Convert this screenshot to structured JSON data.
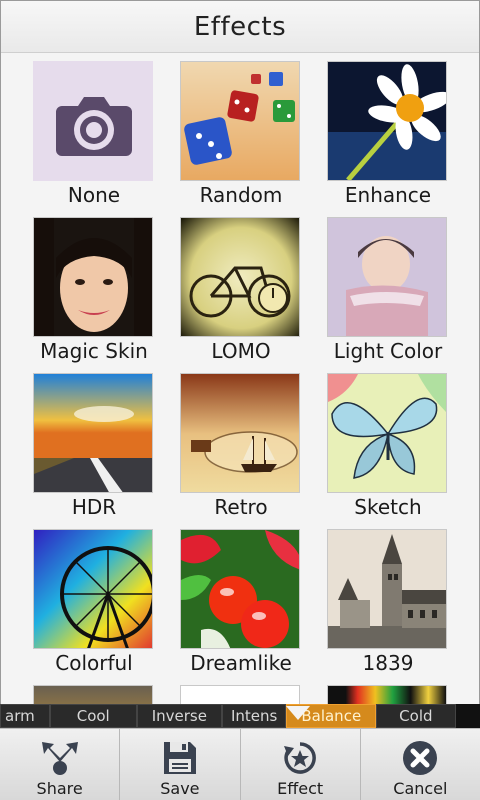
{
  "dialog": {
    "title": "Effects"
  },
  "effects": [
    {
      "label": "None",
      "icon": "camera-icon"
    },
    {
      "label": "Random",
      "icon": "dice-image"
    },
    {
      "label": "Enhance",
      "icon": "daisy-image"
    },
    {
      "label": "Magic Skin",
      "icon": "portrait-image"
    },
    {
      "label": "LOMO",
      "icon": "bicycle-image"
    },
    {
      "label": "Light Color",
      "icon": "girl-scarf-image"
    },
    {
      "label": "HDR",
      "icon": "road-sunset-image"
    },
    {
      "label": "Retro",
      "icon": "ship-bottle-image"
    },
    {
      "label": "Sketch",
      "icon": "butterfly-image"
    },
    {
      "label": "Colorful",
      "icon": "ferris-wheel-image"
    },
    {
      "label": "Dreamlike",
      "icon": "peppers-image"
    },
    {
      "label": "1839",
      "icon": "castle-image"
    }
  ],
  "strip": {
    "items": [
      "arm",
      "Cool",
      "Inverse",
      "Intens",
      "Balance",
      "Cold"
    ],
    "active": "Balance"
  },
  "toolbar": {
    "share": "Share",
    "save": "Save",
    "effect": "Effect",
    "cancel": "Cancel"
  }
}
